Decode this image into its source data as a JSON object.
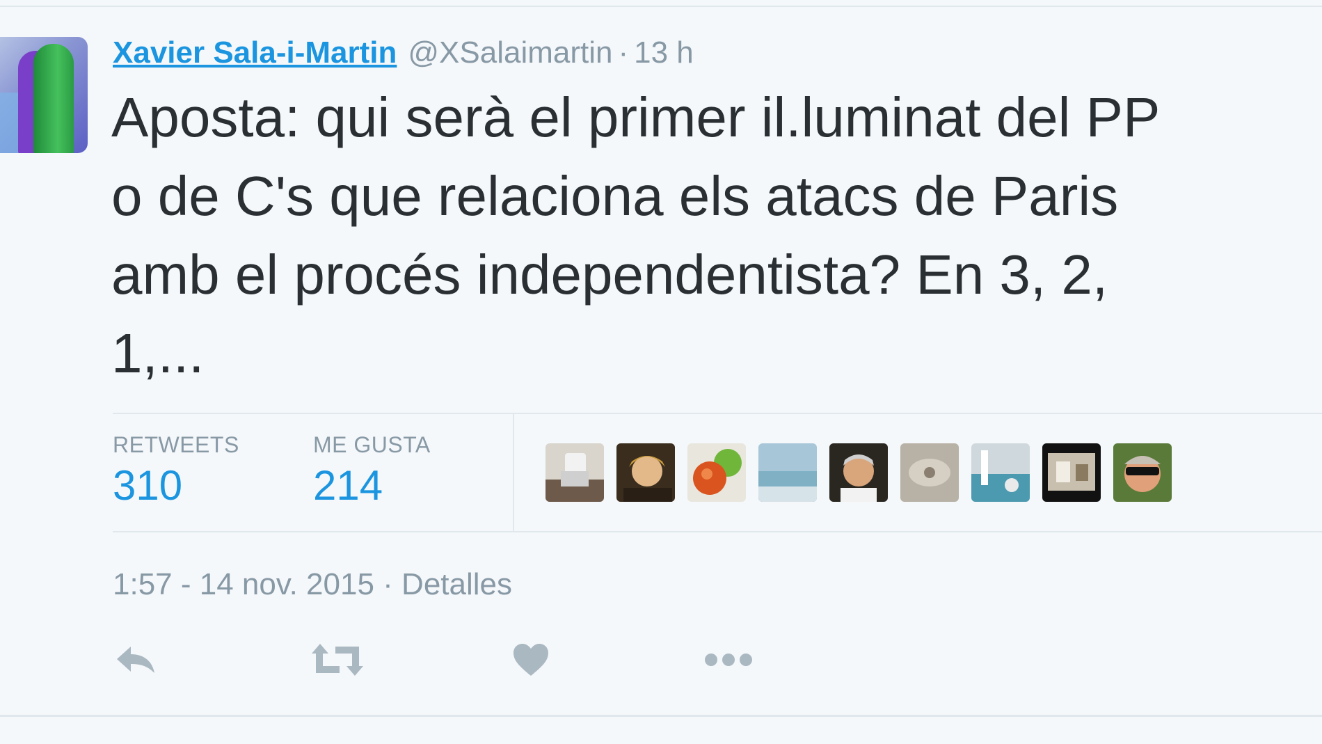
{
  "tweet": {
    "author_name": "Xavier Sala-i-Martin",
    "handle": "@XSalaimartin",
    "separator": "·",
    "relative_time": "13 h",
    "text": "Aposta: qui serà el primer il.luminat del PP\no de C's que relaciona els atacs de Paris\namb el procés independentista? En 3, 2,\n1,..."
  },
  "stats": {
    "retweets_label": "RETWEETS",
    "retweets_count": "310",
    "likes_label": "ME GUSTA",
    "likes_count": "214"
  },
  "timestamp": {
    "datetime": "1:57 - 14 nov. 2015",
    "separator": "·",
    "details_link": "Detalles"
  },
  "actions": {
    "icons": [
      "reply-icon",
      "retweet-icon",
      "like-icon",
      "more-icon"
    ]
  },
  "colors": {
    "link_blue": "#1b95e0",
    "muted_gray": "#8899a6",
    "text_dark": "#292f33",
    "background": "#f5f8fa",
    "divider": "#e1e8ed",
    "action_icon": "#aab8c2"
  }
}
